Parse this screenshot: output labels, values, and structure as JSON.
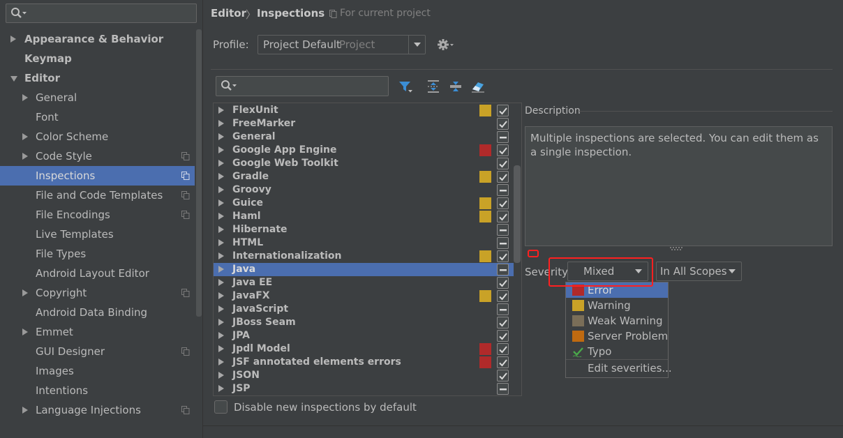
{
  "sidebar": {
    "items": [
      {
        "label": "Appearance & Behavior",
        "bold": true,
        "arrow": "right",
        "indent": 0
      },
      {
        "label": "Keymap",
        "bold": true,
        "arrow": "none",
        "indent": 0
      },
      {
        "label": "Editor",
        "bold": true,
        "arrow": "down",
        "indent": 0
      },
      {
        "label": "General",
        "bold": false,
        "arrow": "right",
        "indent": 1
      },
      {
        "label": "Font",
        "bold": false,
        "arrow": "none",
        "indent": 1
      },
      {
        "label": "Color Scheme",
        "bold": false,
        "arrow": "right",
        "indent": 1
      },
      {
        "label": "Code Style",
        "bold": false,
        "arrow": "right",
        "indent": 1,
        "copy": true
      },
      {
        "label": "Inspections",
        "bold": false,
        "arrow": "none",
        "indent": 1,
        "copy": true,
        "selected": true
      },
      {
        "label": "File and Code Templates",
        "bold": false,
        "arrow": "none",
        "indent": 1,
        "copy": true
      },
      {
        "label": "File Encodings",
        "bold": false,
        "arrow": "none",
        "indent": 1,
        "copy": true
      },
      {
        "label": "Live Templates",
        "bold": false,
        "arrow": "none",
        "indent": 1
      },
      {
        "label": "File Types",
        "bold": false,
        "arrow": "none",
        "indent": 1
      },
      {
        "label": "Android Layout Editor",
        "bold": false,
        "arrow": "none",
        "indent": 1
      },
      {
        "label": "Copyright",
        "bold": false,
        "arrow": "right",
        "indent": 1,
        "copy": true
      },
      {
        "label": "Android Data Binding",
        "bold": false,
        "arrow": "none",
        "indent": 1
      },
      {
        "label": "Emmet",
        "bold": false,
        "arrow": "right",
        "indent": 1
      },
      {
        "label": "GUI Designer",
        "bold": false,
        "arrow": "none",
        "indent": 1,
        "copy": true
      },
      {
        "label": "Images",
        "bold": false,
        "arrow": "none",
        "indent": 1
      },
      {
        "label": "Intentions",
        "bold": false,
        "arrow": "none",
        "indent": 1
      },
      {
        "label": "Language Injections",
        "bold": false,
        "arrow": "right",
        "indent": 1,
        "copy": true
      }
    ]
  },
  "breadcrumb": {
    "part1": "Editor",
    "sep": "〉",
    "part2": "Inspections",
    "scope": "For current project"
  },
  "profile": {
    "label": "Profile:",
    "value": "Project Default",
    "suffix": "Project"
  },
  "inspections": [
    {
      "name": "FlexUnit",
      "severity": "#c9a227",
      "check": "checked"
    },
    {
      "name": "FreeMarker",
      "severity": "",
      "check": "checked"
    },
    {
      "name": "General",
      "severity": "",
      "check": "mixed"
    },
    {
      "name": "Google App Engine",
      "severity": "#b02a2a",
      "check": "checked"
    },
    {
      "name": "Google Web Toolkit",
      "severity": "",
      "check": "checked"
    },
    {
      "name": "Gradle",
      "severity": "#c9a227",
      "check": "checked"
    },
    {
      "name": "Groovy",
      "severity": "",
      "check": "mixed"
    },
    {
      "name": "Guice",
      "severity": "#c9a227",
      "check": "checked"
    },
    {
      "name": "Haml",
      "severity": "#c9a227",
      "check": "checked"
    },
    {
      "name": "Hibernate",
      "severity": "",
      "check": "mixed"
    },
    {
      "name": "HTML",
      "severity": "",
      "check": "mixed"
    },
    {
      "name": "Internationalization",
      "severity": "#c9a227",
      "check": "checked"
    },
    {
      "name": "Java",
      "severity": "",
      "check": "mixed",
      "selected": true
    },
    {
      "name": "Java EE",
      "severity": "",
      "check": "checked"
    },
    {
      "name": "JavaFX",
      "severity": "#c9a227",
      "check": "checked"
    },
    {
      "name": "JavaScript",
      "severity": "",
      "check": "mixed"
    },
    {
      "name": "JBoss Seam",
      "severity": "",
      "check": "checked"
    },
    {
      "name": "JPA",
      "severity": "",
      "check": "checked"
    },
    {
      "name": "Jpdl Model",
      "severity": "#b02a2a",
      "check": "checked"
    },
    {
      "name": "JSF annotated elements errors",
      "severity": "#b02a2a",
      "check": "checked"
    },
    {
      "name": "JSON",
      "severity": "",
      "check": "checked"
    },
    {
      "name": "JSP",
      "severity": "",
      "check": "mixed"
    }
  ],
  "disable_new": {
    "label": "Disable new inspections by default"
  },
  "description": {
    "title": "Description",
    "text": "Multiple inspections are selected. You can edit them as a single inspection."
  },
  "severity": {
    "label": "Severity:",
    "value": "Mixed"
  },
  "scope": {
    "value": "In All Scopes"
  },
  "severity_menu": [
    {
      "label": "Error",
      "color": "#b02a2a",
      "selected": true
    },
    {
      "label": "Warning",
      "color": "#c9a227"
    },
    {
      "label": "Weak Warning",
      "color": "#7a6e58"
    },
    {
      "label": "Server Problem",
      "color": "#c06a10"
    },
    {
      "label": "Typo",
      "color": "#4aa84a",
      "icon": "check-icon"
    },
    {
      "label": "Edit severities...",
      "color": ""
    }
  ],
  "colors": {
    "selection": "#4b6eaf",
    "annotation": "#ff2020"
  }
}
